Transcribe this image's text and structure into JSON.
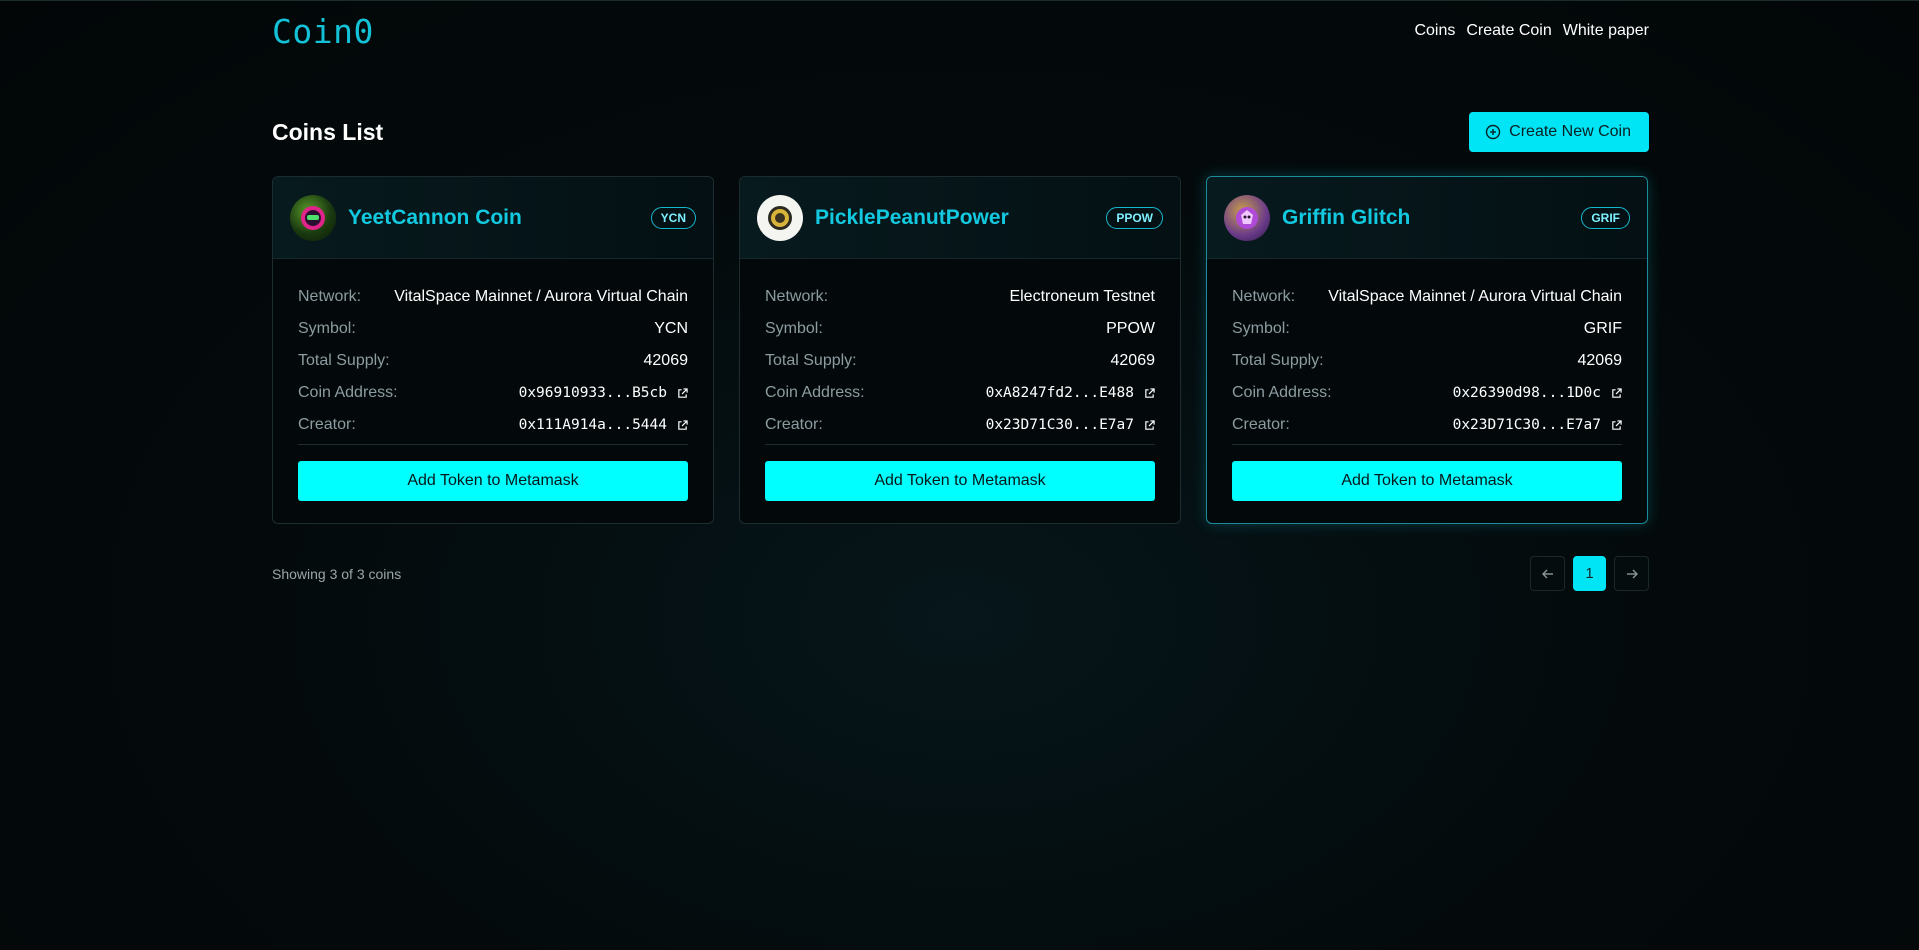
{
  "header": {
    "logo": "Coin0",
    "nav": [
      "Coins",
      "Create Coin",
      "White paper"
    ]
  },
  "page": {
    "title": "Coins List",
    "create_button": "Create New Coin"
  },
  "labels": {
    "network": "Network:",
    "symbol": "Symbol:",
    "supply": "Total Supply:",
    "address": "Coin Address:",
    "creator": "Creator:",
    "add_button": "Add Token to Metamask"
  },
  "coins": [
    {
      "name": "YeetCannon Coin",
      "badge": "YCN",
      "network": "VitalSpace Mainnet / Aurora Virtual Chain",
      "symbol": "YCN",
      "supply": "42069",
      "address": "0x96910933...B5cb",
      "creator": "0x111A914a...5444"
    },
    {
      "name": "PicklePeanutPower",
      "badge": "PPOW",
      "network": "Electroneum Testnet",
      "symbol": "PPOW",
      "supply": "42069",
      "address": "0xA8247fd2...E488",
      "creator": "0x23D71C30...E7a7"
    },
    {
      "name": "Griffin Glitch",
      "badge": "GRIF",
      "network": "VitalSpace Mainnet / Aurora Virtual Chain",
      "symbol": "GRIF",
      "supply": "42069",
      "address": "0x26390d98...1D0c",
      "creator": "0x23D71C30...E7a7"
    }
  ],
  "footer": {
    "showing": "Showing 3 of 3 coins",
    "current_page": "1"
  },
  "colors": {
    "accent": "#00e5f5",
    "button": "#00ffff",
    "coin_name": "#12c9e0",
    "background": "#030809"
  },
  "icons": [
    "plus-circle-icon",
    "external-link-icon",
    "arrow-left-icon",
    "arrow-right-icon"
  ]
}
